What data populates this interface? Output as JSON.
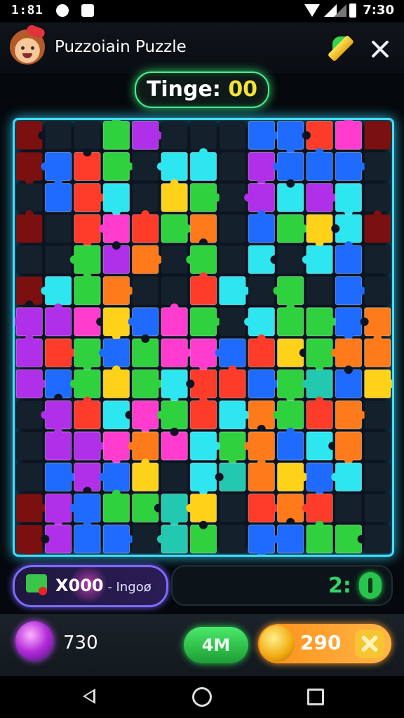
{
  "status_bar": {
    "time_left": "1:81",
    "time_right": "7:30"
  },
  "header": {
    "title": "Puzzoiain Puzzle",
    "icons": [
      "avatar",
      "pencil-icon",
      "close-icon"
    ]
  },
  "score_pill": {
    "label": "Tinge: ",
    "value": "00"
  },
  "board": {
    "rows": 14,
    "cols": 13,
    "palette": {
      "R": "#ff3b2a",
      "O": "#ff7a1a",
      "Y": "#ffd21a",
      "G": "#2fd23e",
      "T": "#22c9b0",
      "C": "#2ee6f0",
      "B": "#1f6bff",
      "P": "#b02fe8",
      "M": "#ff3ccd",
      "D": "#7a1010",
      "E": "#14202c"
    },
    "grid": [
      "DEEGPEEEBBRMD",
      "DBRGECCEPBBBE",
      "EBRCEYGEPCPCE",
      "DERMRGOEBGYCD",
      "EEGPOEGECECBE",
      "DCGOEERCEGEBE",
      "PPMYBMGECGGBO",
      "PRGBGMMBRYGOO",
      "PBGYGCRRBGTBY",
      "EPRCMGRCOGROE",
      "EPPMOMCGOBCOE",
      "EBPBYECTOYBCE",
      "DPBGGTYEROREE",
      "DPBBETGEBBGGE"
    ]
  },
  "bonus": {
    "label": "X000",
    "suffix": " - Ingoø"
  },
  "counter": {
    "value": "2:"
  },
  "footer": {
    "gem_count": "730",
    "play_label": "4M",
    "coin_value": "290"
  },
  "nav": [
    "back",
    "home",
    "recent"
  ]
}
